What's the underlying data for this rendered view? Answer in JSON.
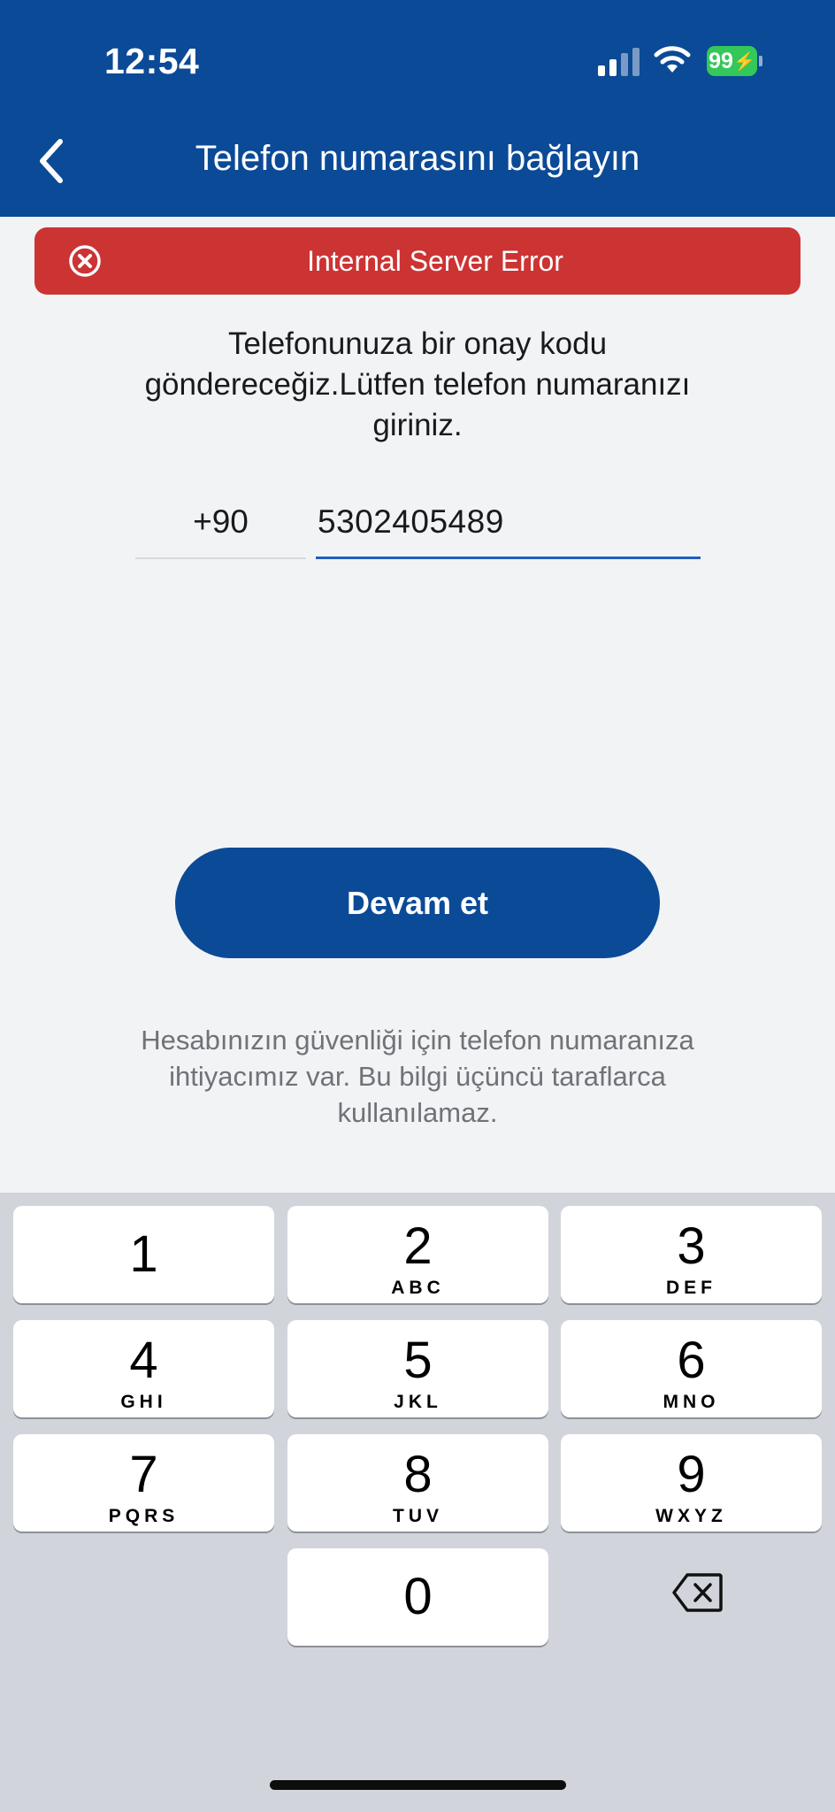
{
  "status_bar": {
    "time": "12:54",
    "battery": "99",
    "icons": [
      "signal-icon",
      "wifi-icon",
      "battery-icon"
    ]
  },
  "nav": {
    "title": "Telefon numarasını bağlayın",
    "back_icon": "chevron-left-icon"
  },
  "error_banner": {
    "icon": "close-circle-icon",
    "text": "Internal Server Error"
  },
  "instructions": "Telefonunuza bir onay kodu göndereceğiz.Lütfen telefon numaranızı giriniz.",
  "phone": {
    "country_code": "+90",
    "number": "5302405489"
  },
  "continue_button": "Devam et",
  "privacy_note": "Hesabınızın güvenliği için telefon numaranıza ihtiyacımız var. Bu bilgi üçüncü taraflarca kullanılamaz.",
  "keyboard": {
    "keys": [
      {
        "digit": "1",
        "letters": ""
      },
      {
        "digit": "2",
        "letters": "ABC"
      },
      {
        "digit": "3",
        "letters": "DEF"
      },
      {
        "digit": "4",
        "letters": "GHI"
      },
      {
        "digit": "5",
        "letters": "JKL"
      },
      {
        "digit": "6",
        "letters": "MNO"
      },
      {
        "digit": "7",
        "letters": "PQRS"
      },
      {
        "digit": "8",
        "letters": "TUV"
      },
      {
        "digit": "9",
        "letters": "WXYZ"
      },
      {
        "digit": "0",
        "letters": ""
      }
    ],
    "delete_icon": "backspace-icon"
  },
  "colors": {
    "brand": "#0b4a96",
    "error": "#cc3333",
    "battery": "#34c759",
    "input_focus": "#1f5fbf"
  }
}
